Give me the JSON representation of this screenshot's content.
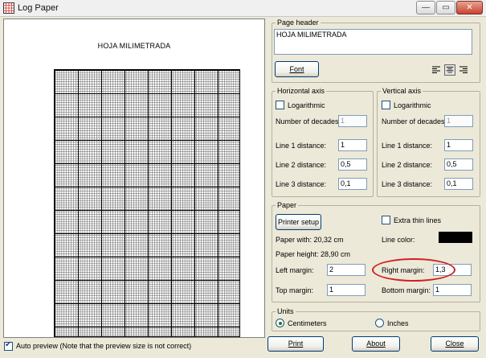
{
  "window": {
    "title": "Log Paper",
    "icon": "grid-icon",
    "minimize": "—",
    "maximize": "▭",
    "close": "✕"
  },
  "preview": {
    "title": "HOJA MILIMETRADA"
  },
  "page_header": {
    "legend": "Page header",
    "text": "HOJA MILIMETRADA",
    "font_button": "Font",
    "alignment_selected": "center"
  },
  "horizontal_axis": {
    "legend": "Horizontal axis",
    "logarithmic_label": "Logarithmic",
    "logarithmic_checked": false,
    "decades_label": "Number of decades:",
    "decades_value": "1",
    "line1_label": "Line 1 distance:",
    "line1_value": "1",
    "line2_label": "Line 2 distance:",
    "line2_value": "0,5",
    "line3_label": "Line 3 distance:",
    "line3_value": "0,1"
  },
  "vertical_axis": {
    "legend": "Vertical axis",
    "logarithmic_label": "Logarithmic",
    "logarithmic_checked": false,
    "decades_label": "Number of decades:",
    "decades_value": "1",
    "line1_label": "Line 1 distance:",
    "line1_value": "1",
    "line2_label": "Line 2 distance:",
    "line2_value": "0,5",
    "line3_label": "Line 3 distance:",
    "line3_value": "0,1"
  },
  "paper": {
    "legend": "Paper",
    "printer_setup": "Printer setup",
    "extra_thin_label": "Extra thin lines",
    "extra_thin_checked": false,
    "width_text": "Paper with: 20,32 cm",
    "height_text": "Paper height: 28,90 cm",
    "line_color_label": "Line color:",
    "line_color": "#000000",
    "left_margin_label": "Left margin:",
    "left_margin_value": "2",
    "right_margin_label": "Right margin:",
    "right_margin_value": "1,3",
    "top_margin_label": "Top margin:",
    "top_margin_value": "1",
    "bottom_margin_label": "Bottom margin:",
    "bottom_margin_value": "1"
  },
  "units": {
    "legend": "Units",
    "centimeters": "Centimeters",
    "inches": "Inches",
    "selected": "Centimeters"
  },
  "footer": {
    "auto_preview_label": "Auto preview (Note that the preview size is not correct)",
    "auto_preview_checked": true,
    "print_button": "Print",
    "about_button": "About",
    "close_button": "Close"
  },
  "colors": {
    "annotation": "#d02020",
    "window_bg": "#ece9d8"
  }
}
